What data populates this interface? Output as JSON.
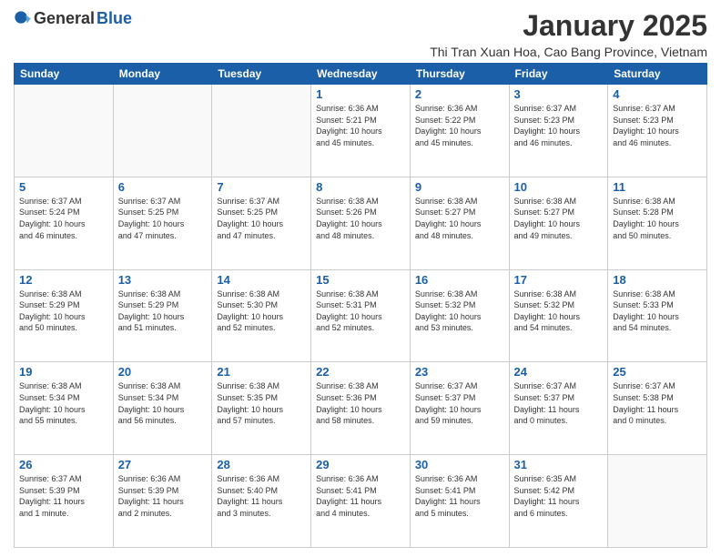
{
  "logo": {
    "general": "General",
    "blue": "Blue"
  },
  "title": "January 2025",
  "location": "Thi Tran Xuan Hoa, Cao Bang Province, Vietnam",
  "days_header": [
    "Sunday",
    "Monday",
    "Tuesday",
    "Wednesday",
    "Thursday",
    "Friday",
    "Saturday"
  ],
  "weeks": [
    [
      {
        "day": "",
        "info": ""
      },
      {
        "day": "",
        "info": ""
      },
      {
        "day": "",
        "info": ""
      },
      {
        "day": "1",
        "info": "Sunrise: 6:36 AM\nSunset: 5:21 PM\nDaylight: 10 hours\nand 45 minutes."
      },
      {
        "day": "2",
        "info": "Sunrise: 6:36 AM\nSunset: 5:22 PM\nDaylight: 10 hours\nand 45 minutes."
      },
      {
        "day": "3",
        "info": "Sunrise: 6:37 AM\nSunset: 5:23 PM\nDaylight: 10 hours\nand 46 minutes."
      },
      {
        "day": "4",
        "info": "Sunrise: 6:37 AM\nSunset: 5:23 PM\nDaylight: 10 hours\nand 46 minutes."
      }
    ],
    [
      {
        "day": "5",
        "info": "Sunrise: 6:37 AM\nSunset: 5:24 PM\nDaylight: 10 hours\nand 46 minutes."
      },
      {
        "day": "6",
        "info": "Sunrise: 6:37 AM\nSunset: 5:25 PM\nDaylight: 10 hours\nand 47 minutes."
      },
      {
        "day": "7",
        "info": "Sunrise: 6:37 AM\nSunset: 5:25 PM\nDaylight: 10 hours\nand 47 minutes."
      },
      {
        "day": "8",
        "info": "Sunrise: 6:38 AM\nSunset: 5:26 PM\nDaylight: 10 hours\nand 48 minutes."
      },
      {
        "day": "9",
        "info": "Sunrise: 6:38 AM\nSunset: 5:27 PM\nDaylight: 10 hours\nand 48 minutes."
      },
      {
        "day": "10",
        "info": "Sunrise: 6:38 AM\nSunset: 5:27 PM\nDaylight: 10 hours\nand 49 minutes."
      },
      {
        "day": "11",
        "info": "Sunrise: 6:38 AM\nSunset: 5:28 PM\nDaylight: 10 hours\nand 50 minutes."
      }
    ],
    [
      {
        "day": "12",
        "info": "Sunrise: 6:38 AM\nSunset: 5:29 PM\nDaylight: 10 hours\nand 50 minutes."
      },
      {
        "day": "13",
        "info": "Sunrise: 6:38 AM\nSunset: 5:29 PM\nDaylight: 10 hours\nand 51 minutes."
      },
      {
        "day": "14",
        "info": "Sunrise: 6:38 AM\nSunset: 5:30 PM\nDaylight: 10 hours\nand 52 minutes."
      },
      {
        "day": "15",
        "info": "Sunrise: 6:38 AM\nSunset: 5:31 PM\nDaylight: 10 hours\nand 52 minutes."
      },
      {
        "day": "16",
        "info": "Sunrise: 6:38 AM\nSunset: 5:32 PM\nDaylight: 10 hours\nand 53 minutes."
      },
      {
        "day": "17",
        "info": "Sunrise: 6:38 AM\nSunset: 5:32 PM\nDaylight: 10 hours\nand 54 minutes."
      },
      {
        "day": "18",
        "info": "Sunrise: 6:38 AM\nSunset: 5:33 PM\nDaylight: 10 hours\nand 54 minutes."
      }
    ],
    [
      {
        "day": "19",
        "info": "Sunrise: 6:38 AM\nSunset: 5:34 PM\nDaylight: 10 hours\nand 55 minutes."
      },
      {
        "day": "20",
        "info": "Sunrise: 6:38 AM\nSunset: 5:34 PM\nDaylight: 10 hours\nand 56 minutes."
      },
      {
        "day": "21",
        "info": "Sunrise: 6:38 AM\nSunset: 5:35 PM\nDaylight: 10 hours\nand 57 minutes."
      },
      {
        "day": "22",
        "info": "Sunrise: 6:38 AM\nSunset: 5:36 PM\nDaylight: 10 hours\nand 58 minutes."
      },
      {
        "day": "23",
        "info": "Sunrise: 6:37 AM\nSunset: 5:37 PM\nDaylight: 10 hours\nand 59 minutes."
      },
      {
        "day": "24",
        "info": "Sunrise: 6:37 AM\nSunset: 5:37 PM\nDaylight: 11 hours\nand 0 minutes."
      },
      {
        "day": "25",
        "info": "Sunrise: 6:37 AM\nSunset: 5:38 PM\nDaylight: 11 hours\nand 0 minutes."
      }
    ],
    [
      {
        "day": "26",
        "info": "Sunrise: 6:37 AM\nSunset: 5:39 PM\nDaylight: 11 hours\nand 1 minute."
      },
      {
        "day": "27",
        "info": "Sunrise: 6:36 AM\nSunset: 5:39 PM\nDaylight: 11 hours\nand 2 minutes."
      },
      {
        "day": "28",
        "info": "Sunrise: 6:36 AM\nSunset: 5:40 PM\nDaylight: 11 hours\nand 3 minutes."
      },
      {
        "day": "29",
        "info": "Sunrise: 6:36 AM\nSunset: 5:41 PM\nDaylight: 11 hours\nand 4 minutes."
      },
      {
        "day": "30",
        "info": "Sunrise: 6:36 AM\nSunset: 5:41 PM\nDaylight: 11 hours\nand 5 minutes."
      },
      {
        "day": "31",
        "info": "Sunrise: 6:35 AM\nSunset: 5:42 PM\nDaylight: 11 hours\nand 6 minutes."
      },
      {
        "day": "",
        "info": ""
      }
    ]
  ]
}
